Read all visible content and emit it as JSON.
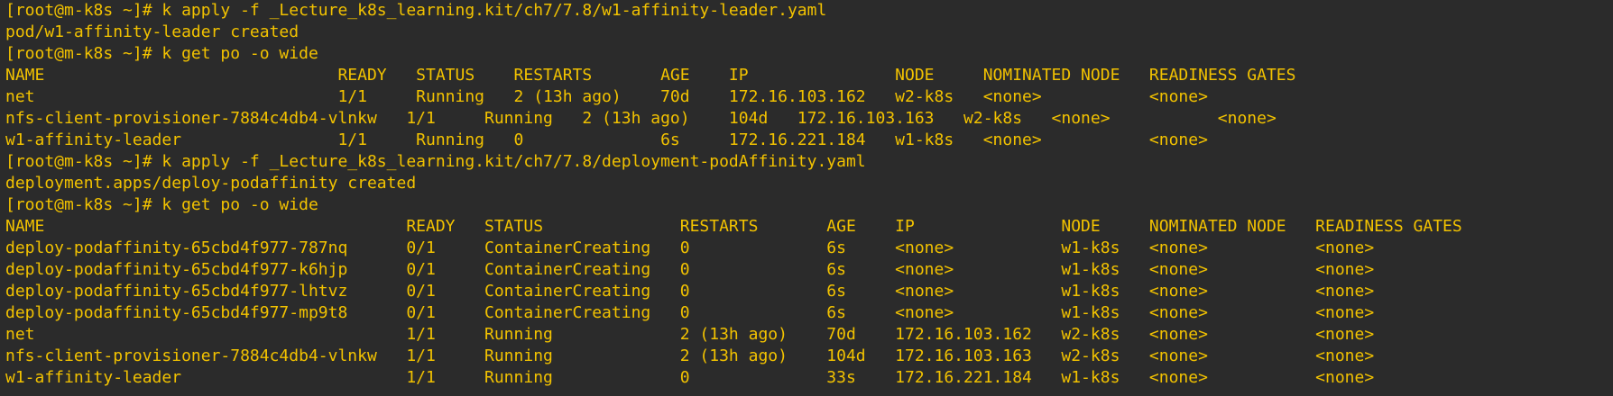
{
  "terminal": {
    "lines": [
      "[root@m-k8s ~]# k apply -f _Lecture_k8s_learning.kit/ch7/7.8/w1-affinity-leader.yaml",
      "pod/w1-affinity-leader created",
      "[root@m-k8s ~]# k get po -o wide",
      "NAME                              READY   STATUS    RESTARTS       AGE    IP               NODE     NOMINATED NODE   READINESS GATES",
      "net                               1/1     Running   2 (13h ago)    70d    172.16.103.162   w2-k8s   <none>           <none>",
      "nfs-client-provisioner-7884c4db4-vlnkw   1/1     Running   2 (13h ago)    104d   172.16.103.163   w2-k8s   <none>           <none>",
      "w1-affinity-leader                1/1     Running   0              6s     172.16.221.184   w1-k8s   <none>           <none>",
      "[root@m-k8s ~]# k apply -f _Lecture_k8s_learning.kit/ch7/7.8/deployment-podAffinity.yaml",
      "deployment.apps/deploy-podaffinity created",
      "[root@m-k8s ~]# k get po -o wide",
      "NAME                                     READY   STATUS              RESTARTS       AGE    IP               NODE     NOMINATED NODE   READINESS GATES",
      "deploy-podaffinity-65cbd4f977-787nq      0/1     ContainerCreating   0              6s     <none>           w1-k8s   <none>           <none>",
      "deploy-podaffinity-65cbd4f977-k6hjp      0/1     ContainerCreating   0              6s     <none>           w1-k8s   <none>           <none>",
      "deploy-podaffinity-65cbd4f977-lhtvz      0/1     ContainerCreating   0              6s     <none>           w1-k8s   <none>           <none>",
      "deploy-podaffinity-65cbd4f977-mp9t8      0/1     ContainerCreating   0              6s     <none>           w1-k8s   <none>           <none>",
      "net                                      1/1     Running             2 (13h ago)    70d    172.16.103.162   w2-k8s   <none>           <none>",
      "nfs-client-provisioner-7884c4db4-vlnkw   1/1     Running             2 (13h ago)    104d   172.16.103.163   w2-k8s   <none>           <none>",
      "w1-affinity-leader                       1/1     Running             0              33s    172.16.221.184   w1-k8s   <none>           <none>"
    ]
  }
}
